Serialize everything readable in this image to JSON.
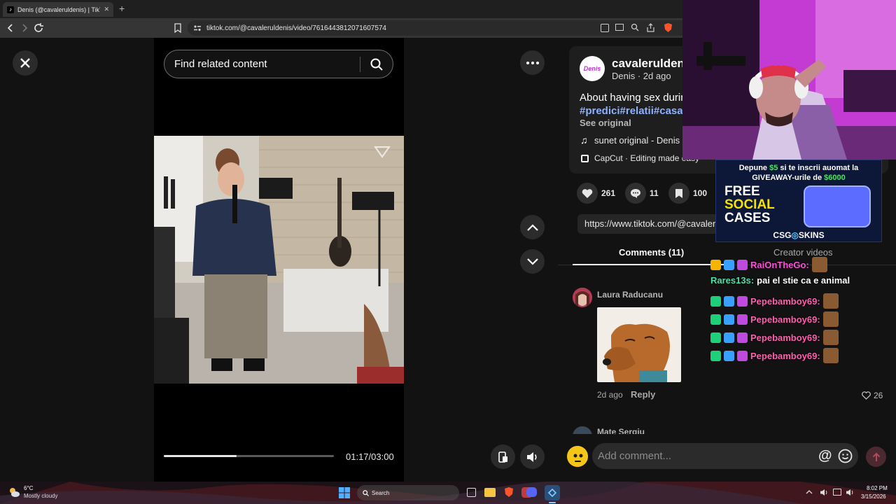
{
  "browser": {
    "tab_title": "Denis (@cavaleruldenis) | TikTok",
    "tab_close": "✕",
    "new_tab": "+",
    "url": "tiktok.com/@cavaleruldenis/video/7616443812071607574"
  },
  "video": {
    "search_placeholder": "Find related content",
    "time_display": "01:17/03:00",
    "progress_fraction": 0.43
  },
  "post": {
    "username": "cavaleruldenis",
    "avatar_text": "Denis",
    "meta": "Denis · 2d ago",
    "caption": "About having sex during",
    "hashtags": "#predici#relatii#casat",
    "see_original": "See original",
    "sound": "sunet original - Denis",
    "capcut": "CapCut · Editing made easy",
    "likes": "261",
    "comments": "11",
    "saves": "100",
    "link": "https://www.tiktok.com/@cavaleruldenis"
  },
  "tabs": {
    "comments": "Comments (11)",
    "creator_videos": "Creator videos"
  },
  "comments_list": [
    {
      "author": "Laura Raducanu",
      "age": "2d ago",
      "reply": "Reply",
      "likes": "26"
    },
    {
      "author": "Mate Sergiu"
    }
  ],
  "composer": {
    "placeholder": "Add comment...",
    "at": "@"
  },
  "overlay": {
    "ad_line1_pre": "Depune ",
    "ad_amount1": "$5",
    "ad_line1_post": " si te inscrii auomat la",
    "ad_line2_pre": "GIVEAWAY-urile de ",
    "ad_amount2": "$6000",
    "ad_free": "FREE",
    "ad_social": "SOCIAL",
    "ad_cases": "CASES",
    "ad_brand": "CSG SKINS",
    "ad_csg": "CSG",
    "ad_skins": "SKINS",
    "chat": [
      {
        "user": "RaiOnTheGo:",
        "message": "",
        "color": "#ff4fd8"
      },
      {
        "user": "Rares13s:",
        "message": "pai el stie ca e animal",
        "color": "#4fe0a8"
      },
      {
        "user": "Pepebamboy69:",
        "message": "",
        "color": "#ff5fb0"
      },
      {
        "user": "Pepebamboy69:",
        "message": "",
        "color": "#ff5fb0"
      },
      {
        "user": "Pepebamboy69:",
        "message": "",
        "color": "#ff5fb0"
      },
      {
        "user": "Pepebamboy69:",
        "message": "",
        "color": "#ff5fb0"
      }
    ]
  },
  "taskbar": {
    "temp": "6°C",
    "weather": "Mostly cloudy",
    "search": "Search",
    "time": "8:02 PM",
    "date": "3/15/2026"
  },
  "colors": {
    "tiktok_red": "#fe2c55",
    "hashtag": "#8fb2ff",
    "page_bg": "#121212"
  }
}
